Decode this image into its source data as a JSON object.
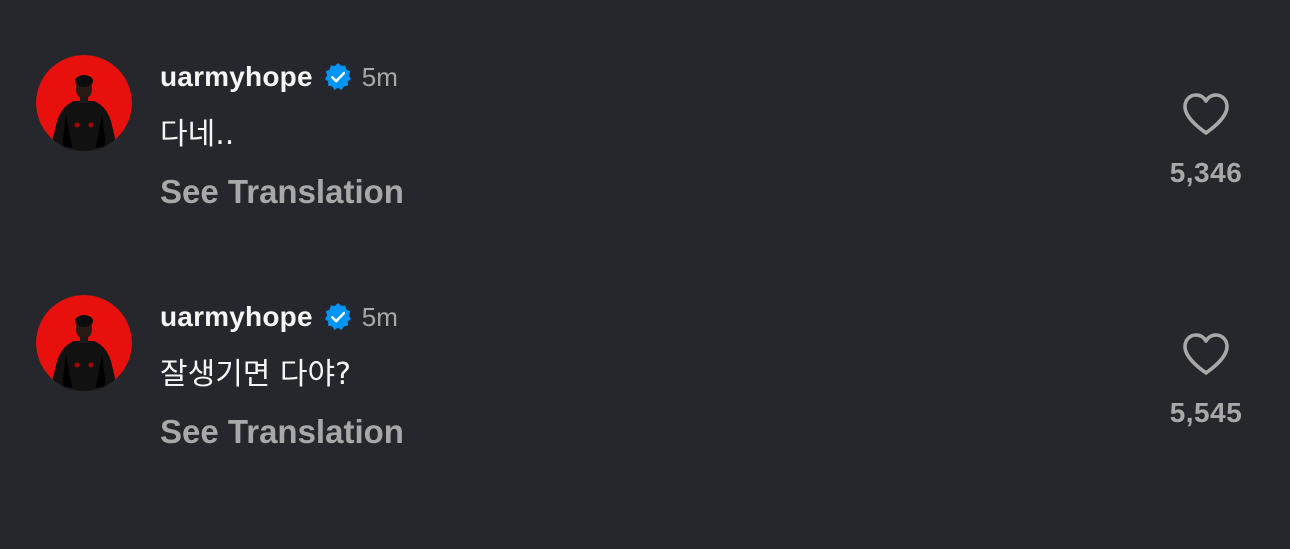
{
  "colors": {
    "background": "#25272c",
    "text_primary": "#f5f5f5",
    "text_secondary": "#a8a8a8",
    "verified_badge": "#0095f6",
    "avatar_background": "#e8100c"
  },
  "comments": [
    {
      "username": "uarmyhope",
      "verified": true,
      "time": "5m",
      "text": "다네..",
      "translate_label": "See Translation",
      "like_icon": "heart-outline-icon",
      "like_count": "5,346"
    },
    {
      "username": "uarmyhope",
      "verified": true,
      "time": "5m",
      "text": "잘생기면 다야?",
      "translate_label": "See Translation",
      "like_icon": "heart-outline-icon",
      "like_count": "5,545"
    }
  ]
}
